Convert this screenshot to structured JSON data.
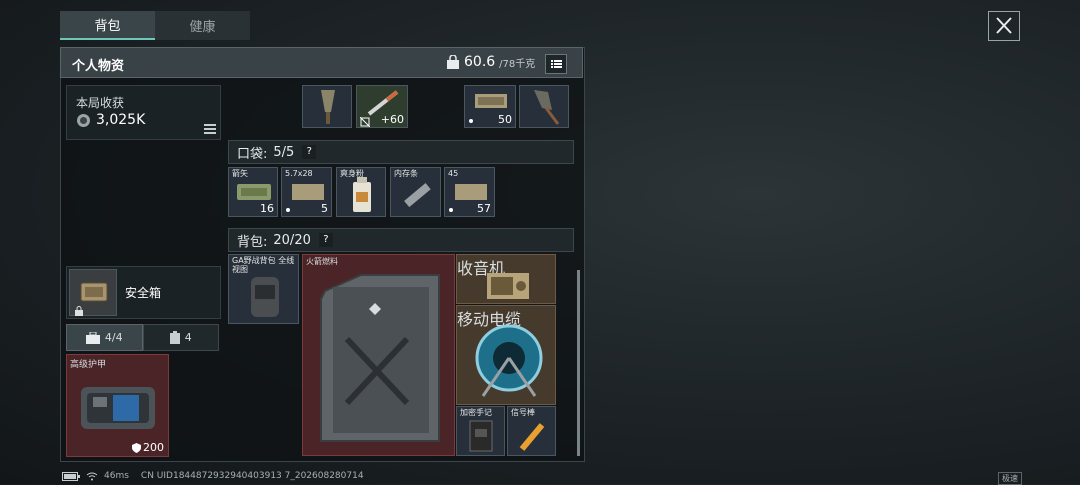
{
  "tabs": [
    {
      "label": "背包"
    },
    {
      "label": "健康"
    }
  ],
  "header": {
    "title": "个人物资",
    "weight": "60.6",
    "weight_max": "/78千克"
  },
  "earnings": {
    "label": "本局收获",
    "value": "3,025K"
  },
  "safe_box": {
    "label": "安全箱"
  },
  "equip_tabs": {
    "armor_count": "4/4",
    "bag_count": "4"
  },
  "armor": {
    "label": "高级护甲",
    "durability": "200"
  },
  "top_items": [
    {
      "label": "",
      "count": ""
    },
    {
      "label": "",
      "count": "+60"
    },
    {
      "label": "",
      "count": "50"
    },
    {
      "label": "",
      "count": ""
    }
  ],
  "pocket": {
    "label": "口袋:",
    "count": "5/5",
    "help": "?"
  },
  "pocket_items": [
    {
      "label": "箭矢",
      "count": "16"
    },
    {
      "label": "5.7x28",
      "count": "5"
    },
    {
      "label": "爽身粉",
      "count": ""
    },
    {
      "label": "内存条",
      "count": ""
    },
    {
      "label": "45",
      "count": "57"
    }
  ],
  "backpack": {
    "label": "背包:",
    "count": "20/20",
    "help": "?"
  },
  "backpack_items": [
    {
      "label": "GA野战背包 全线视图",
      "count": ""
    },
    {
      "label": "火箭燃料",
      "count": ""
    },
    {
      "label": "收音机",
      "count": ""
    },
    {
      "label": "移动电缆",
      "count": ""
    },
    {
      "label": "加密手记",
      "count": ""
    },
    {
      "label": "信号棒",
      "count": ""
    }
  ],
  "status": {
    "ping": "46ms",
    "uid": "CN UID1844872932940403913 7_202608280714",
    "badge": "极速"
  },
  "colors": {
    "accent": "#6fc7b9",
    "red_rarity": "#4a2426",
    "gold_rarity": "#463a2c",
    "blue_rarity": "#2b3c4c"
  }
}
